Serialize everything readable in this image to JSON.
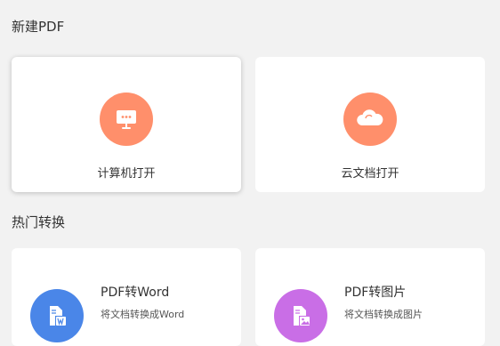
{
  "sections": {
    "new_pdf": "新建PDF",
    "hot_convert": "热门转换"
  },
  "open_cards": [
    {
      "label": "计算机打开",
      "icon": "computer-monitor-icon",
      "color": "#ff8f6b"
    },
    {
      "label": "云文档打开",
      "icon": "cloud-icon",
      "color": "#ff8f6b"
    }
  ],
  "convert_cards": [
    {
      "title": "PDF转Word",
      "desc": "将文档转换成Word",
      "icon": "pdf-to-word-icon",
      "color": "#4a86e8"
    },
    {
      "title": "PDF转图片",
      "desc": "将文档转换成图片",
      "icon": "pdf-to-image-icon",
      "color": "#c96ee6"
    }
  ]
}
